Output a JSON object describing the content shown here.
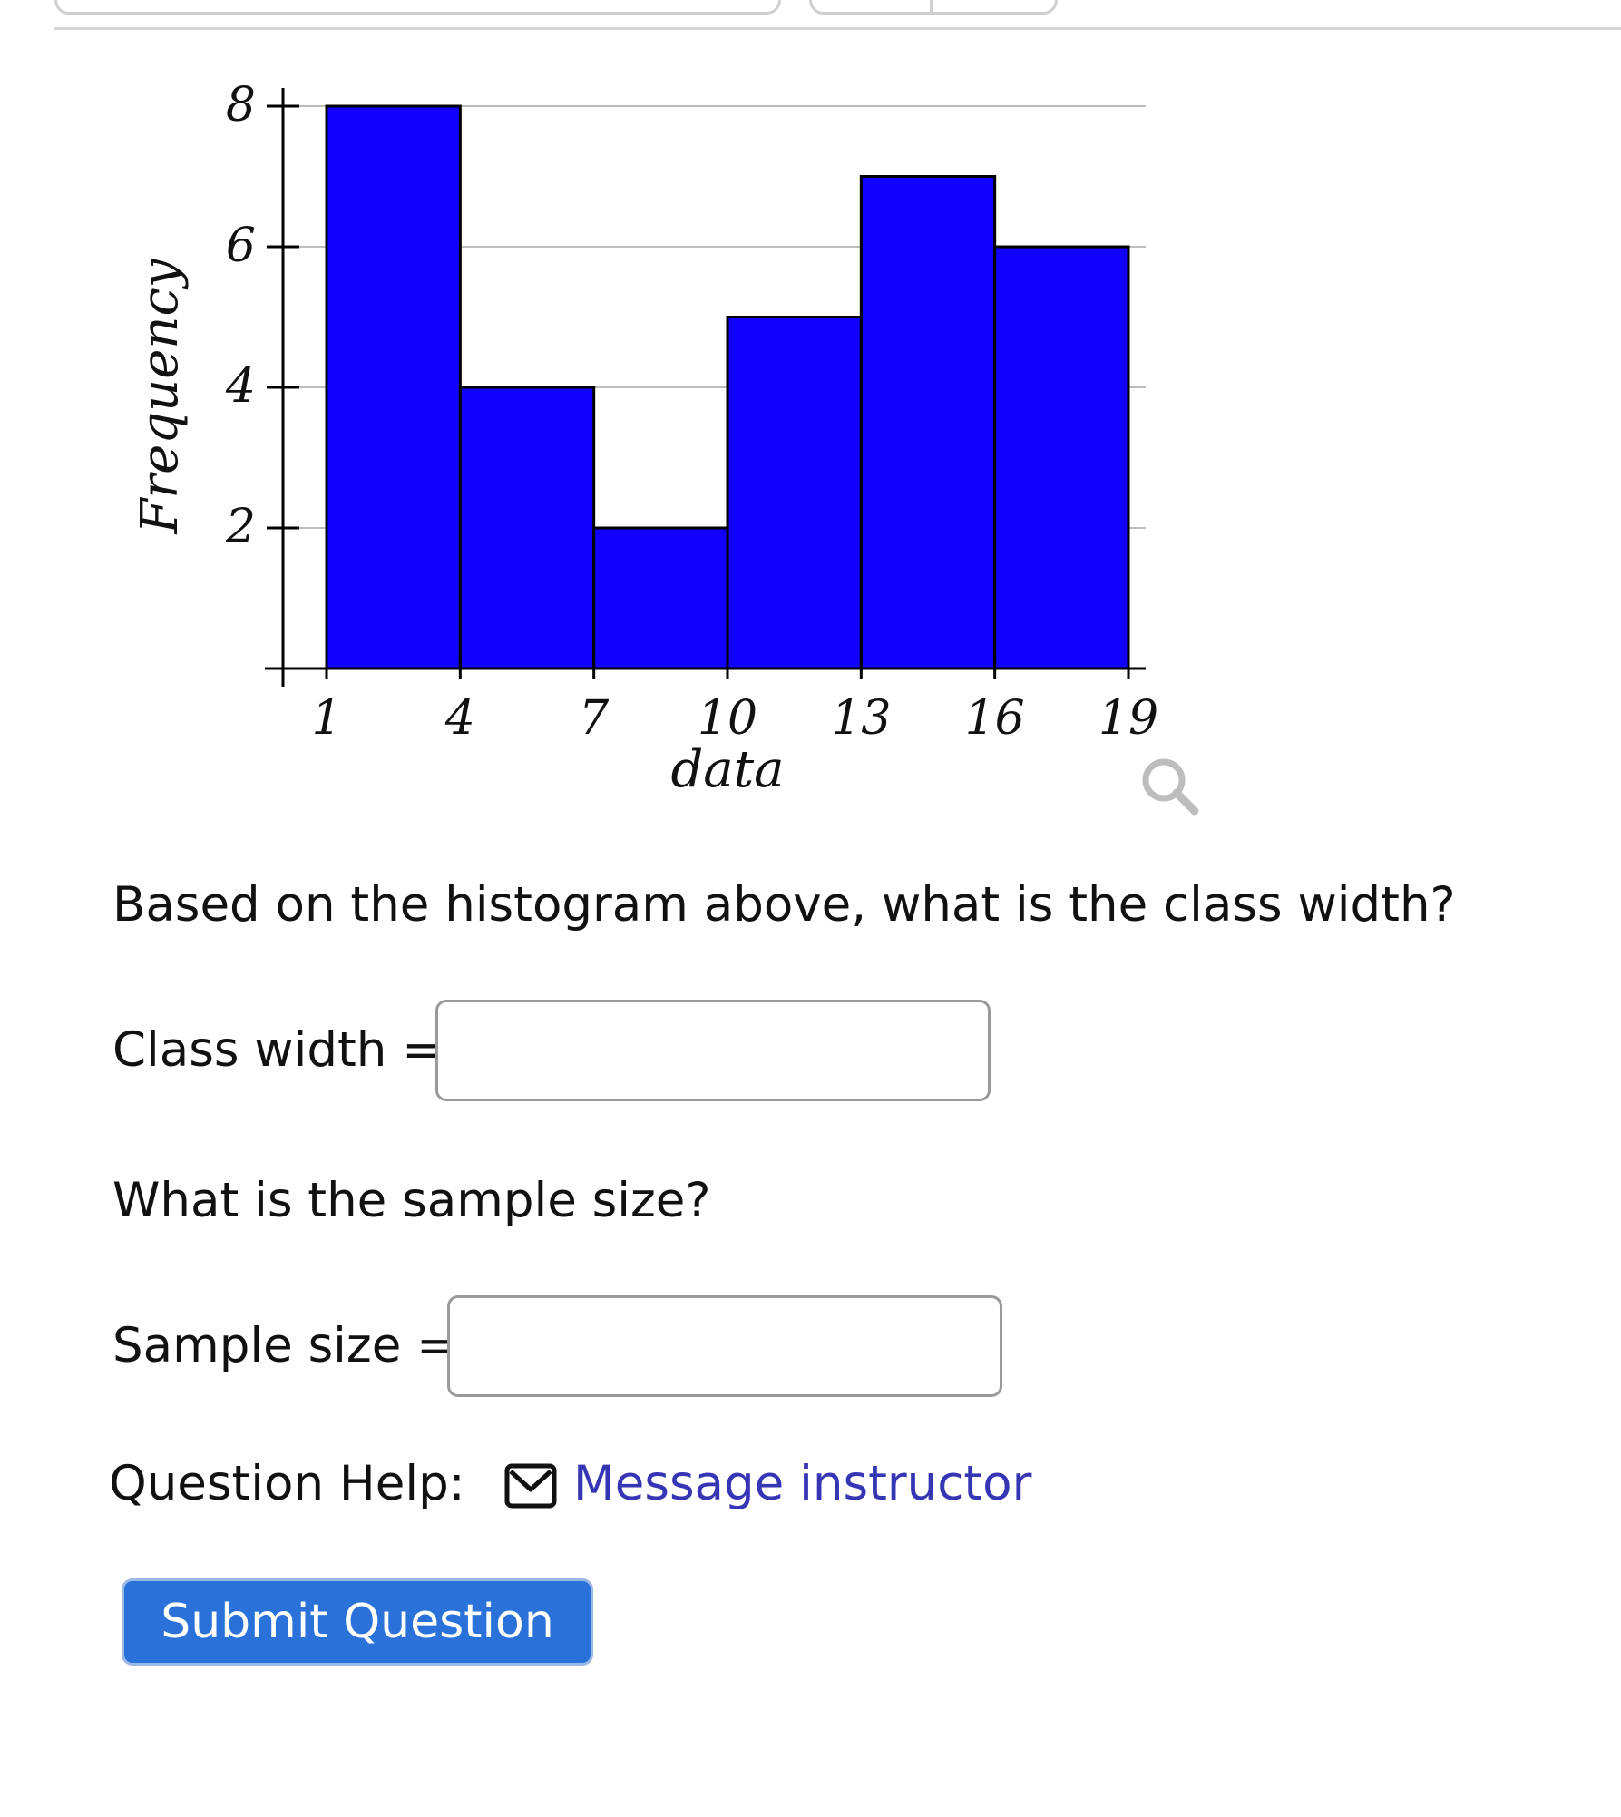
{
  "chart_data": {
    "type": "bar",
    "variant": "histogram",
    "bins": [
      {
        "from": 1,
        "to": 4,
        "value": 8
      },
      {
        "from": 4,
        "to": 7,
        "value": 4
      },
      {
        "from": 7,
        "to": 10,
        "value": 2
      },
      {
        "from": 10,
        "to": 13,
        "value": 5
      },
      {
        "from": 13,
        "to": 16,
        "value": 7
      },
      {
        "from": 16,
        "to": 19,
        "value": 6
      }
    ],
    "x_ticks": [
      "1",
      "4",
      "7",
      "10",
      "13",
      "16",
      "19"
    ],
    "y_ticks": [
      "2",
      "4",
      "6",
      "8"
    ],
    "xlabel": "data",
    "ylabel": "Frequency",
    "xlim": [
      1,
      19
    ],
    "ylim": [
      0,
      8
    ],
    "grid": "horizontal",
    "bar_color": "#1200ff"
  },
  "chart_tools": {
    "zoom_icon": "magnifier-icon"
  },
  "question1": {
    "text": "Based on the histogram above, what is the class width?",
    "label": "Class width =",
    "value": ""
  },
  "question2": {
    "text": "What is the sample size?",
    "label": "Sample size =",
    "value": ""
  },
  "help": {
    "label": "Question Help:",
    "icon": "envelope-icon",
    "link_text": "Message instructor",
    "link_color": "#3636b4"
  },
  "submit": {
    "label": "Submit Question",
    "color": "#2a72d9"
  }
}
